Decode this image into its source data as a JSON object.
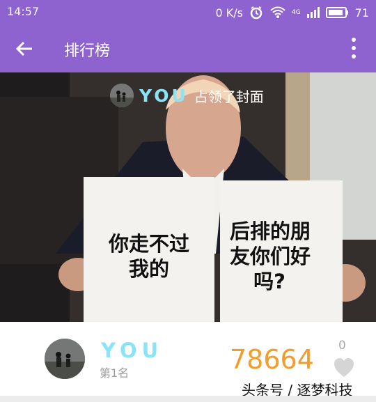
{
  "status": {
    "time": "14:57",
    "net_speed": "0 K/s",
    "signal": "4G",
    "battery": "71"
  },
  "header": {
    "title": "排行榜",
    "back_icon": "arrow-left-icon",
    "menu_icon": "more-vertical-icon"
  },
  "cover": {
    "claimant": "YOU",
    "claim_text": "占领了封面",
    "sign_left": [
      "你走不过",
      "我的"
    ],
    "sign_right": [
      "后排的朋",
      "友你们好",
      "吗?"
    ]
  },
  "leaderboard": {
    "name": "YOU",
    "rank": "第1名",
    "score": "78664",
    "likes": "0"
  },
  "watermark": "头条号 / 逐梦科技",
  "colors": {
    "accent": "#8e63d0",
    "name": "#8be4f5",
    "score": "#f19d2b"
  }
}
